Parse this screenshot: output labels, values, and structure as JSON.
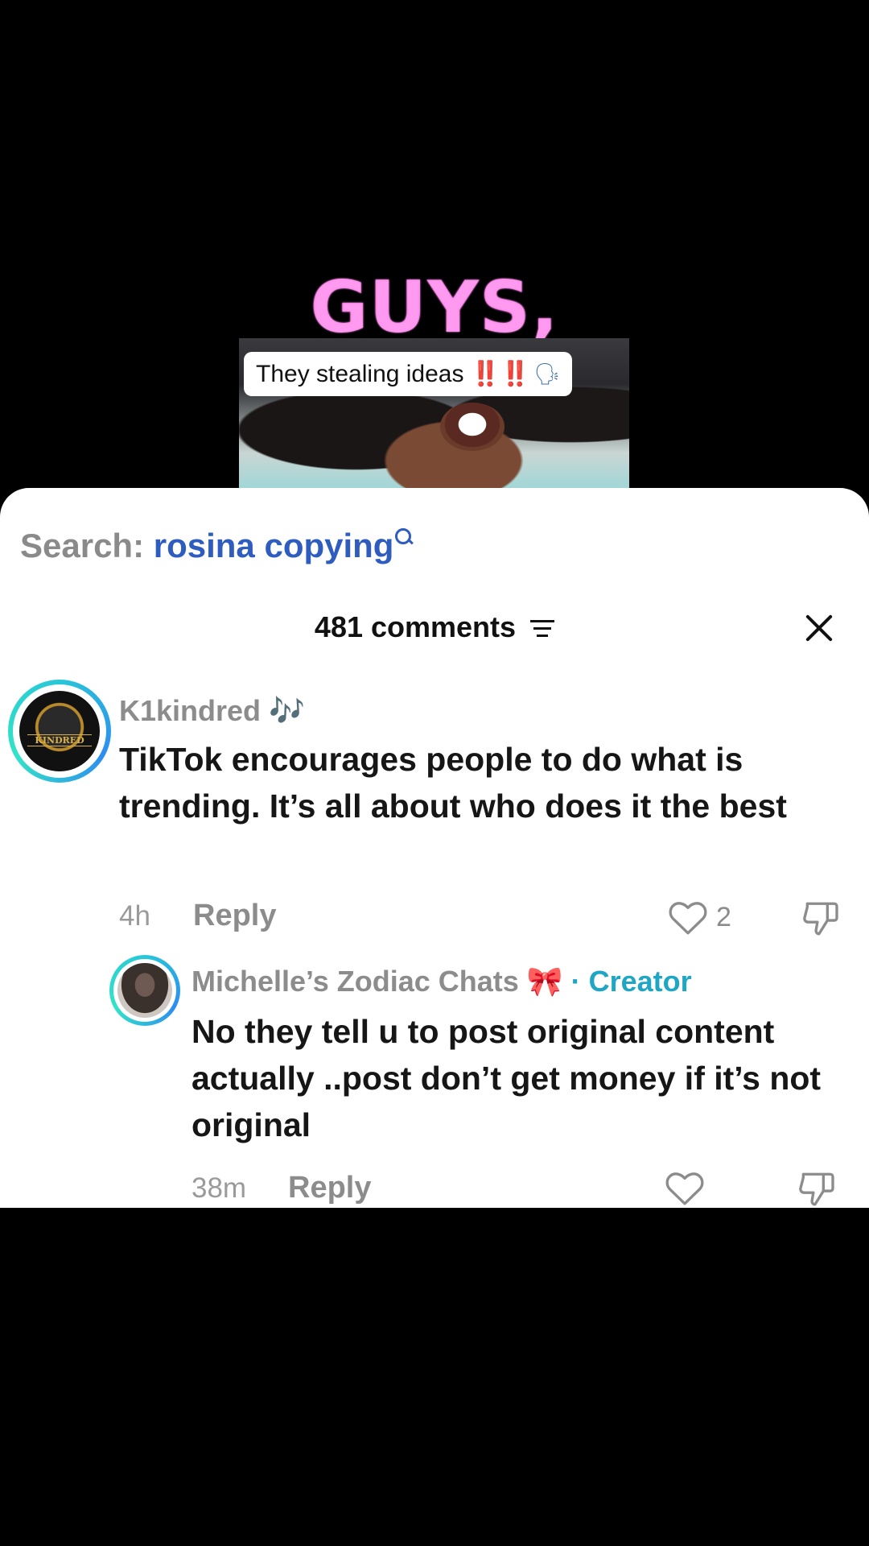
{
  "video": {
    "overlay_title": "GUYS,",
    "caption": "They stealing ideas",
    "caption_bangs": "‼️‼️",
    "caption_emoji": "🗣"
  },
  "search": {
    "label": "Search:",
    "query": "rosina copying"
  },
  "comments_header": {
    "count_label": "481 comments"
  },
  "comments": [
    {
      "username": "K1kindred",
      "username_suffix": "🎶",
      "text": "TikTok encourages people to do what is trending. It’s all about who does it the best",
      "time": "4h",
      "reply_label": "Reply",
      "likes": "2",
      "avatar_badge": "KINDRED"
    },
    {
      "username": "Michelle’s Zodiac Chats",
      "username_suffix": "🎀",
      "creator_label": "· Creator",
      "text": "No they tell u to post original content actually ..post don’t get money if it’s not original",
      "time": "38m",
      "reply_label": "Reply"
    }
  ],
  "colors": {
    "overlay_pink": "#ff4fe0",
    "search_blue": "#2f5cbf",
    "creator_teal": "#1fa6c4",
    "ring_teal": "#28c7d8"
  }
}
